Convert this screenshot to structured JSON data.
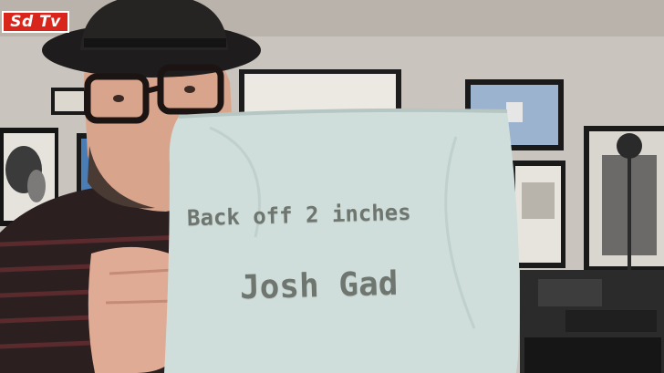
{
  "channel_badge": {
    "label": "Sd Tv",
    "color": "#d9261c"
  },
  "pillow": {
    "line1": "Back off 2 inches",
    "line2": "Josh Gad",
    "fabric_color": "#cfdedb",
    "text_color": "#6f756f"
  }
}
